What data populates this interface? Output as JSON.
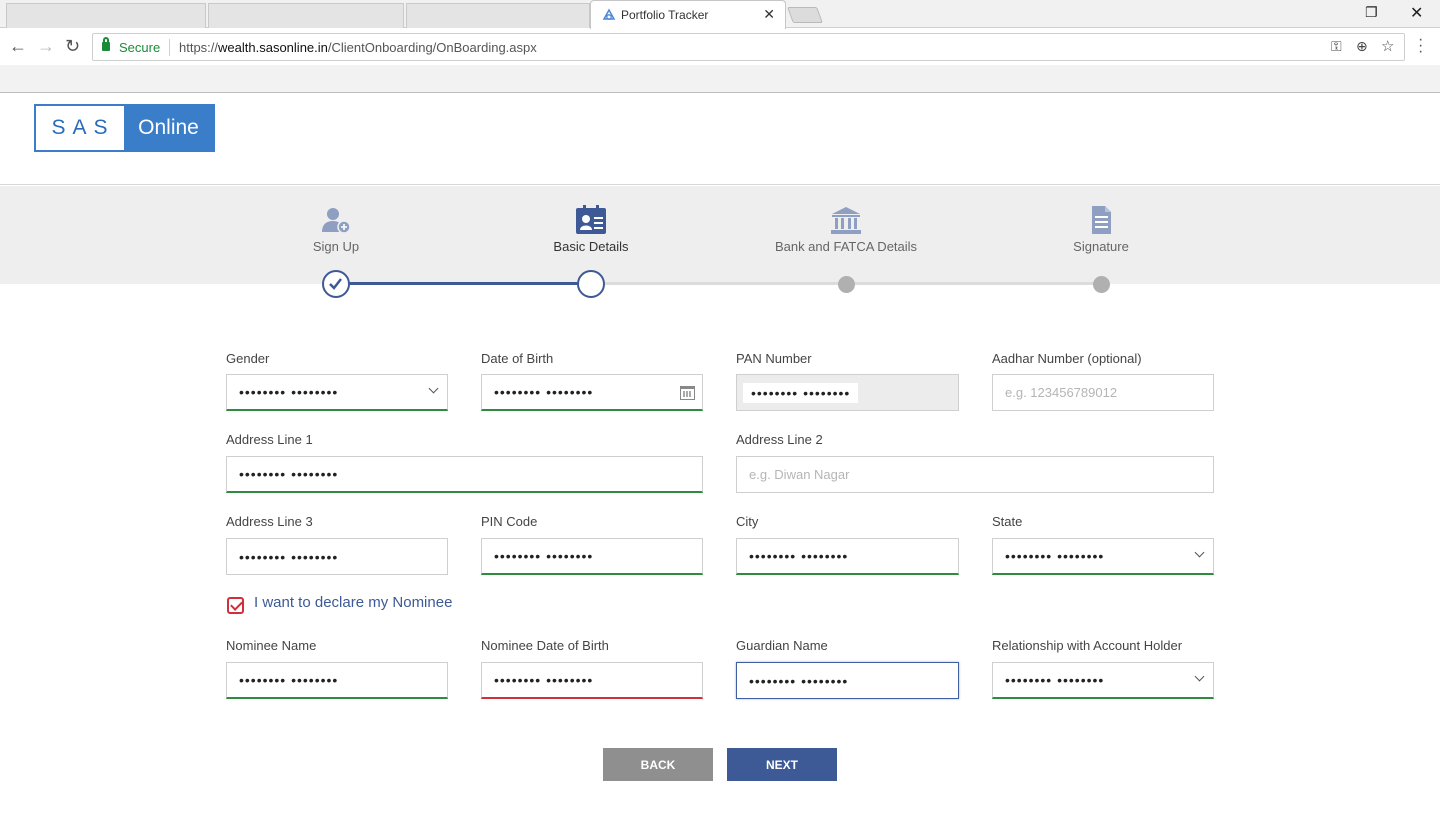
{
  "browser": {
    "tab_title": "Portfolio Tracker",
    "secure_label": "Secure",
    "url_prefix": "https://",
    "url_host": "wealth.sasonline.in",
    "url_path": "/ClientOnboarding/OnBoarding.aspx"
  },
  "logo": {
    "left": "SAS",
    "right": "Online"
  },
  "steps": [
    {
      "label": "Sign Up",
      "state": "done"
    },
    {
      "label": "Basic Details",
      "state": "current"
    },
    {
      "label": "Bank and FATCA Details",
      "state": "pending"
    },
    {
      "label": "Signature",
      "state": "pending"
    }
  ],
  "form": {
    "gender": {
      "label": "Gender",
      "value": "•••••••• ••••••••"
    },
    "dob": {
      "label": "Date of Birth",
      "value": "•••••••• ••••••••"
    },
    "pan": {
      "label": "PAN Number",
      "value": "•••••••• ••••••••"
    },
    "aadhar": {
      "label": "Aadhar Number (optional)",
      "placeholder": "e.g. 123456789012"
    },
    "address1": {
      "label": "Address Line 1",
      "value": "•••••••• ••••••••"
    },
    "address2": {
      "label": "Address Line 2",
      "placeholder": "e.g. Diwan Nagar"
    },
    "address3": {
      "label": "Address Line 3",
      "value": "•••••••• ••••••••"
    },
    "pin": {
      "label": "PIN Code",
      "value": "•••••••• ••••••••"
    },
    "city": {
      "label": "City",
      "value": "•••••••• ••••••••"
    },
    "state": {
      "label": "State",
      "value": "•••••••• ••••••••"
    },
    "nominee_toggle": {
      "label": "I want to declare my Nominee",
      "checked": true
    },
    "nominee_name": {
      "label": "Nominee Name",
      "value": "•••••••• ••••••••"
    },
    "nominee_dob": {
      "label": "Nominee Date of Birth",
      "value": "•••••••• ••••••••"
    },
    "guardian": {
      "label": "Guardian Name",
      "value": "•••••••• ••••••••"
    },
    "relationship": {
      "label": "Relationship with Account Holder",
      "value": "•••••••• ••••••••"
    }
  },
  "buttons": {
    "back": "BACK",
    "next": "NEXT"
  },
  "colors": {
    "brand": "#3d5a96",
    "logo_blue": "#3a7dc9",
    "valid": "#2e8b3f",
    "error": "#d0303a"
  }
}
